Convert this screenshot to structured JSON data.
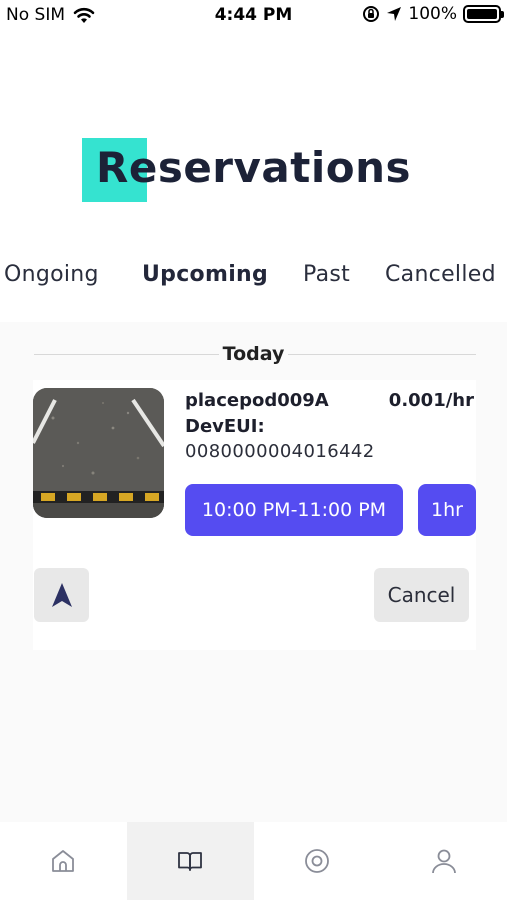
{
  "status_bar": {
    "carrier": "No SIM",
    "time": "4:44 PM",
    "battery": "100%",
    "icons": [
      "wifi-icon",
      "rotation-lock-icon",
      "location-arrow-icon",
      "battery-icon"
    ]
  },
  "page": {
    "title": "Reservations",
    "accent_color": "#35e3d0"
  },
  "tabs": [
    {
      "label": "Ongoing",
      "active": false
    },
    {
      "label": "Upcoming",
      "active": true
    },
    {
      "label": "Past",
      "active": false
    },
    {
      "label": "Cancelled",
      "active": false
    }
  ],
  "section": {
    "title": "Today"
  },
  "reservation": {
    "spot_name": "placepod009A",
    "price": "0.001/hr",
    "deveui_label": "DevEUI:",
    "deveui_value": "0080000004016442",
    "time_range": "10:00 PM-11:00 PM",
    "duration": "1hr",
    "cancel_label": "Cancel",
    "button_color": "#554cf1"
  },
  "bottom_nav": [
    {
      "icon": "home-icon",
      "active": false
    },
    {
      "icon": "book-icon",
      "active": true
    },
    {
      "icon": "target-icon",
      "active": false
    },
    {
      "icon": "user-icon",
      "active": false
    }
  ]
}
